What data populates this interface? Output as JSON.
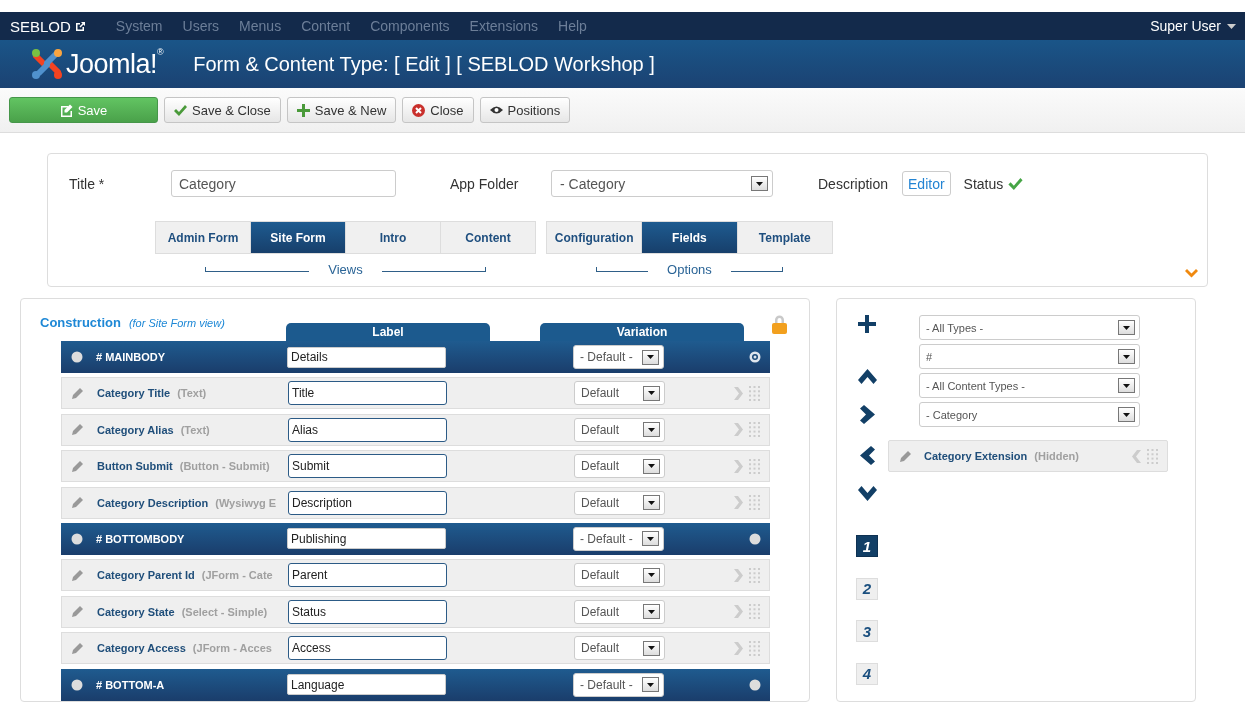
{
  "nav": {
    "brand": "SEBLOD",
    "menu": [
      {
        "label": "System",
        "disabled": true
      },
      {
        "label": "Users",
        "disabled": true
      },
      {
        "label": "Menus",
        "disabled": true
      },
      {
        "label": "Content",
        "disabled": true
      },
      {
        "label": "Components",
        "disabled": true
      },
      {
        "label": "Extensions",
        "disabled": true
      },
      {
        "label": "Help",
        "disabled": true
      }
    ],
    "user": "Super User"
  },
  "header": {
    "logo_text": "Joomla!$^{®}$",
    "title": "Form & Content Type: [ Edit ] [ SEBLOD Workshop ]"
  },
  "toolbar": {
    "buttons": [
      {
        "label": "Save",
        "kind": "save"
      },
      {
        "label": "Save & Close",
        "kind": "check"
      },
      {
        "label": "Save & New",
        "kind": "plus"
      },
      {
        "label": "Close",
        "kind": "close"
      },
      {
        "label": "Positions",
        "kind": "eye"
      }
    ]
  },
  "form_head": {
    "title_label": "Title",
    "required_mark": "*",
    "title_value": "Category",
    "app_folder_label": "App Folder",
    "app_folder_value": "- Category",
    "description_label": "Description",
    "editor_button": "Editor",
    "status_label": "Status",
    "status_on": true,
    "views": {
      "caption": "Views",
      "tabs": [
        {
          "label": "Admin Form",
          "selected": false
        },
        {
          "label": "Site Form",
          "selected": true
        },
        {
          "label": "Intro",
          "selected": false
        },
        {
          "label": "Content",
          "selected": false
        }
      ]
    },
    "options": {
      "caption": "Options",
      "tabs": [
        {
          "label": "Configuration",
          "selected": false
        },
        {
          "label": "Fields",
          "selected": true
        },
        {
          "label": "Template",
          "selected": false
        }
      ]
    }
  },
  "construction": {
    "title": "Construction",
    "subtitle": "(for Site Form view)",
    "columns": [
      "Label",
      "Variation"
    ],
    "rows": [
      {
        "kind": "position",
        "name": "# MAINBODY",
        "label": "Details",
        "variation": "- Default -",
        "selected": true
      },
      {
        "kind": "field",
        "name": "Category Title",
        "type": "(Text)",
        "label": "Title",
        "variation": "Default"
      },
      {
        "kind": "field",
        "name": "Category Alias",
        "type": "(Text)",
        "label": "Alias",
        "variation": "Default"
      },
      {
        "kind": "field",
        "name": "Button Submit",
        "type": "(Button - Submit)",
        "label": "Submit",
        "variation": "Default"
      },
      {
        "kind": "field",
        "name": "Category Description",
        "type": "(Wysiwyg E",
        "label": "Description",
        "variation": "Default"
      },
      {
        "kind": "position",
        "name": "# BOTTOMBODY",
        "label": "Publishing",
        "variation": "- Default -",
        "selected": false
      },
      {
        "kind": "field",
        "name": "Category Parent Id",
        "type": "(JForm - Cate",
        "label": "Parent",
        "variation": "Default"
      },
      {
        "kind": "field",
        "name": "Category State",
        "type": "(Select - Simple)",
        "label": "Status",
        "variation": "Default"
      },
      {
        "kind": "field",
        "name": "Category Access",
        "type": "(JForm - Acces",
        "label": "Access",
        "variation": "Default"
      },
      {
        "kind": "position",
        "name": "# BOTTOM-A",
        "label": "Language",
        "variation": "- Default -",
        "selected": false
      }
    ]
  },
  "side": {
    "filters": [
      "- All Types -",
      "#",
      "- All Content Types -",
      "- Category"
    ],
    "fields": [
      {
        "name": "Category Extension",
        "type": "(Hidden)"
      }
    ],
    "pages": [
      {
        "label": "1",
        "selected": true
      },
      {
        "label": "2",
        "selected": false
      },
      {
        "label": "3",
        "selected": false
      },
      {
        "label": "4",
        "selected": false
      }
    ]
  }
}
